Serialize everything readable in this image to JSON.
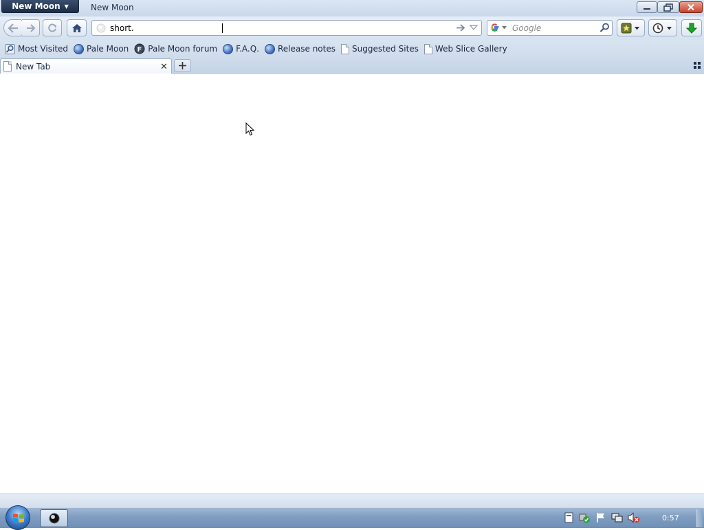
{
  "titlebar": {
    "app_button_label": "New Moon",
    "window_title": "New Moon"
  },
  "navbar": {
    "url_value": "short.",
    "search_placeholder": "Google"
  },
  "bookmarks": [
    {
      "label": "Most Visited",
      "icon": "most-visited-icon"
    },
    {
      "label": "Pale Moon",
      "icon": "globe-icon"
    },
    {
      "label": "Pale Moon forum",
      "icon": "forum-icon"
    },
    {
      "label": "F.A.Q.",
      "icon": "globe-icon"
    },
    {
      "label": "Release notes",
      "icon": "globe-icon"
    },
    {
      "label": "Suggested Sites",
      "icon": "page-icon"
    },
    {
      "label": "Web Slice Gallery",
      "icon": "page-icon"
    }
  ],
  "tabs": [
    {
      "label": "New Tab",
      "selected": true
    }
  ],
  "taskbar": {
    "clock": "0:57"
  },
  "colors": {
    "chrome_blue": "#d6e2f0",
    "app_button": "#1c2d47",
    "close_red": "#c7432a",
    "download_green": "#1fa12b"
  }
}
